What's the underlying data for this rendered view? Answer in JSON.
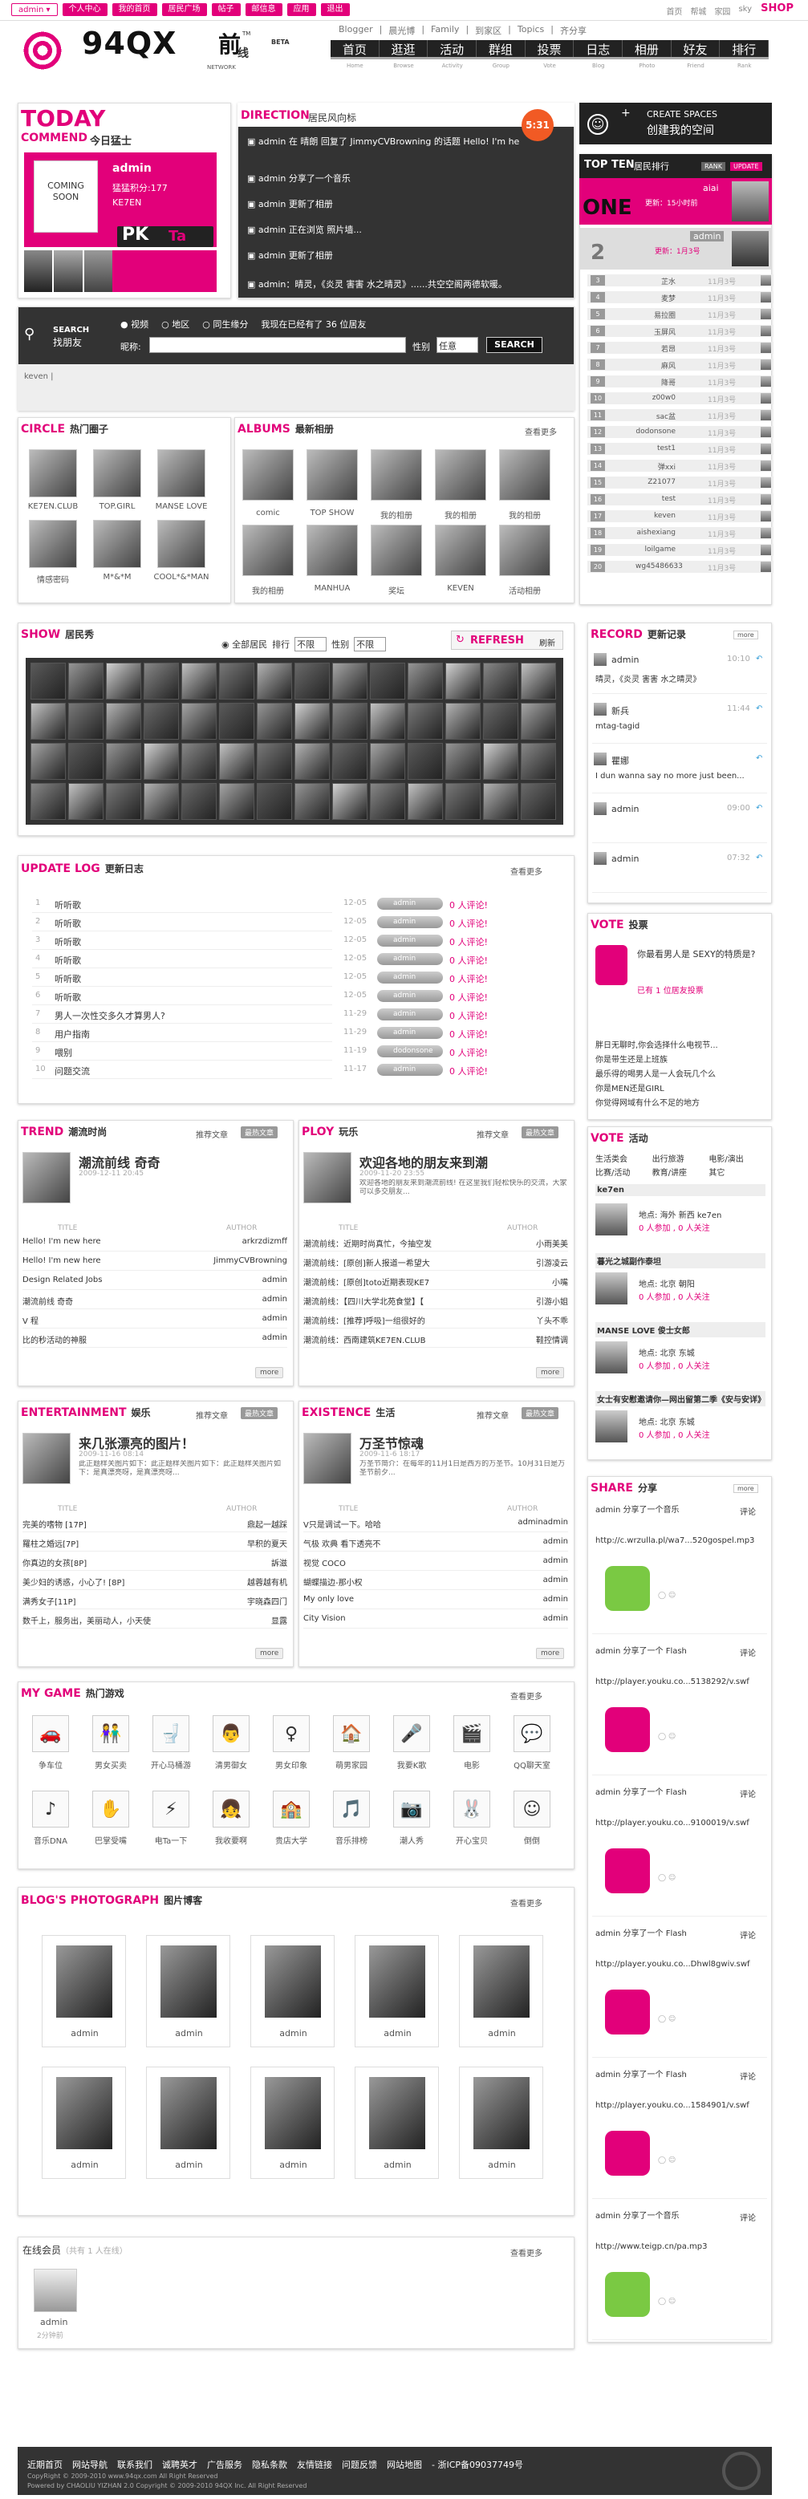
{
  "topbar": {
    "user": "admin ▾",
    "nav": [
      "个人中心",
      "我的首页",
      "居民广场",
      "帖子",
      "邮信息",
      "应用",
      "退出"
    ],
    "links": [
      "首页",
      "帮城",
      "家园",
      "sky"
    ],
    "shop": "SHOP"
  },
  "header": {
    "logo": "94QX",
    "logo_qian": "前",
    "logo_xian": "线",
    "beta": "BETA",
    "tm": "TM",
    "network": "NETWORK",
    "sublinks": [
      "Blogger",
      "晨光博",
      "Family",
      "到家区",
      "Topics",
      "齐分享"
    ],
    "mainnav": [
      "首页",
      "逛逛",
      "活动",
      "群组",
      "投票",
      "日志",
      "相册",
      "好友",
      "排行"
    ],
    "mainnav_sub": [
      "Home",
      "Browse",
      "Activity",
      "Group",
      "Vote",
      "Blog",
      "Photo",
      "Friend",
      "Rank"
    ]
  },
  "today": {
    "title": "TODAY",
    "subtitle": "COMMEND",
    "cn": "今日猛士",
    "name": "admin",
    "score": "猛猛积分:177",
    "tag": "KE7EN",
    "pk": "PK",
    "ta": "Ta",
    "coming": "COMING SOON"
  },
  "direction": {
    "title": "DIRECTION",
    "cn": "居民风向标",
    "badge": "5:31",
    "items": [
      "admin 在 晴朗 回复了 JimmyCVBrowning 的话题 Hello! I'm here",
      "admin 分享了一个音乐",
      "admin 更新了相册",
      "admin 正在浏览 照片墙...",
      "admin 更新了相册",
      "admin：晴灵，《炎灵 害害 水之晴灵》......共空空阁两德软暖。"
    ]
  },
  "search": {
    "title": "SEARCH",
    "cn": "找朋友",
    "options": [
      "视频",
      "地区",
      "同生缘分"
    ],
    "note": "我现在已经有了 36 位居友",
    "nick_label": "昵称:",
    "sex_label": "性别",
    "sex_value": "任意",
    "button": "SEARCH",
    "footer": "keven |"
  },
  "create": {
    "line1": "CREATE SPACES",
    "line2": "创建我的空间"
  },
  "topten": {
    "title": "TOP TEN",
    "cn": "居民排行",
    "tabs": [
      "RANK",
      "UPDATE"
    ],
    "one_name": "aiai",
    "one_label": "ONE",
    "one_note": "更新：15小时前",
    "two_name": "admin",
    "two_label": "2",
    "two_note": "更新：1月3号",
    "rows": [
      {
        "n": "3",
        "name": "芷水",
        "score": "11月3号"
      },
      {
        "n": "4",
        "name": "麦梦",
        "score": "11月3号"
      },
      {
        "n": "5",
        "name": "易拉圈",
        "score": "11月3号"
      },
      {
        "n": "6",
        "name": "玉屏风",
        "score": "11月3号"
      },
      {
        "n": "7",
        "name": "若昂",
        "score": "11月3号"
      },
      {
        "n": "8",
        "name": "麻风",
        "score": "11月3号"
      },
      {
        "n": "9",
        "name": "降哥",
        "score": "11月3号"
      },
      {
        "n": "10",
        "name": "z00w0",
        "score": "11月3号"
      },
      {
        "n": "11",
        "name": "sac盆",
        "score": "11月3号"
      },
      {
        "n": "12",
        "name": "dodonsone",
        "score": "11月3号"
      },
      {
        "n": "13",
        "name": "test1",
        "score": "11月3号"
      },
      {
        "n": "14",
        "name": "弹xxi",
        "score": "11月3号"
      },
      {
        "n": "15",
        "name": "Z21077",
        "score": "11月3号"
      },
      {
        "n": "16",
        "name": "test",
        "score": "11月3号"
      },
      {
        "n": "17",
        "name": "keven",
        "score": "11月3号"
      },
      {
        "n": "18",
        "name": "aishexiang",
        "score": "11月3号"
      },
      {
        "n": "19",
        "name": "loilgame",
        "score": "11月3号"
      },
      {
        "n": "20",
        "name": "wg45486633",
        "score": "11月3号"
      }
    ]
  },
  "circle": {
    "title": "CIRCLE",
    "cn": "热门圈子",
    "items": [
      "KE7EN.CLUB",
      "TOP.GIRL",
      "MANSE LOVE",
      "情感密码",
      "M*&*M",
      "COOL*&*MAN"
    ]
  },
  "albums": {
    "title": "ALBUMS",
    "cn": "最新相册",
    "more": "查看更多",
    "items": [
      "comic",
      "TOP SHOW",
      "我的相册",
      "我的相册",
      "我的相册",
      "我的相册",
      "MANHUA",
      "奖坛",
      "KEVEN",
      "活动相册"
    ]
  },
  "show": {
    "title": "SHOW",
    "cn": "居民秀",
    "option": "全部居民",
    "rank_label": "排行",
    "rank_value": "不限",
    "sex_label": "性别",
    "sex_value": "不限",
    "refresh": "REFRESH",
    "refresh_cn": "刷新"
  },
  "record": {
    "title": "RECORD",
    "cn": "更新记录",
    "more": "more",
    "items": [
      {
        "name": "admin",
        "time": "10:10",
        "text": "晴灵，《炎灵 害害 水之晴灵》"
      },
      {
        "name": "新兵",
        "time": "11:44",
        "text": "mtag-tagid"
      },
      {
        "name": "瞿娜",
        "time": "",
        "text": "I dun wanna say no more just been..."
      },
      {
        "name": "admin",
        "time": "09:00",
        "text": ""
      },
      {
        "name": "admin",
        "time": "07:32",
        "text": ""
      }
    ]
  },
  "updatelog": {
    "title": "UPDATE LOG",
    "cn": "更新日志",
    "more": "查看更多",
    "items": [
      {
        "n": "1",
        "t": "听听歌",
        "d": "12-05",
        "u": "admin",
        "c": "0 人评论!"
      },
      {
        "n": "2",
        "t": "听听歌",
        "d": "12-05",
        "u": "admin",
        "c": "0 人评论!"
      },
      {
        "n": "3",
        "t": "听听歌",
        "d": "12-05",
        "u": "admin",
        "c": "0 人评论!"
      },
      {
        "n": "4",
        "t": "听听歌",
        "d": "12-05",
        "u": "admin",
        "c": "0 人评论!"
      },
      {
        "n": "5",
        "t": "听听歌",
        "d": "12-05",
        "u": "admin",
        "c": "0 人评论!"
      },
      {
        "n": "6",
        "t": "听听歌",
        "d": "12-05",
        "u": "admin",
        "c": "0 人评论!"
      },
      {
        "n": "7",
        "t": "男人一次性交多久才算男人?",
        "d": "11-29",
        "u": "admin",
        "c": "0 人评论!"
      },
      {
        "n": "8",
        "t": "用户指南",
        "d": "11-29",
        "u": "admin",
        "c": "0 人评论!"
      },
      {
        "n": "9",
        "t": "喂别",
        "d": "11-19",
        "u": "dodonsone",
        "c": "0 人评论!"
      },
      {
        "n": "10",
        "t": "问题交流",
        "d": "11-17",
        "u": "admin",
        "c": "0 人评论!"
      }
    ]
  },
  "vote": {
    "title": "VOTE",
    "cn": "投票",
    "question": "你最看男人是 SEXY的特质是?",
    "stat": "已有 1 位居友投票",
    "items": [
      "胖日无聊时,你会选择什么电视节...",
      "你是带生还是上班族",
      "最乐得的喝男人是一人会玩几个么",
      "你是MEN还是GIRL",
      "你觉得网域有什么不足的地方"
    ]
  },
  "vote_activity": {
    "title": "VOTE",
    "cn": "活动",
    "tags": [
      "生活类会",
      "出行旅游",
      "电影/演出",
      "比赛/活动",
      "教育/讲座",
      "其它"
    ],
    "items": [
      {
        "name": "ke7en",
        "addr": "地点: 海外 新西 ke7en",
        "count": "0 人参加 , 0 人关注"
      },
      {
        "name": "暮光之城副作泰坦",
        "addr": "地点: 北京 朝阳",
        "count": "0 人参加 , 0 人关注"
      },
      {
        "name": "MANSE LOVE 俊士女郎",
        "addr": "地点: 北京 东城",
        "count": "0 人参加 , 0 人关注"
      },
      {
        "name": "女士有安慰邀请你—网出留第二季《安与安详》",
        "addr": "地点: 北京 东城",
        "count": "0 人参加 , 0 人关注"
      }
    ]
  },
  "trend": {
    "title": "TREND",
    "cn": "潮流时尚",
    "tabs": [
      "推荐文章",
      "最热文章"
    ],
    "feature": "潮流前线 奇奇",
    "date": "2009-12-11 20:45",
    "col_title": "TITLE",
    "col_author": "AUTHOR",
    "rows": [
      {
        "t": "Hello! I'm new here",
        "a": "arkrzdizmff"
      },
      {
        "t": "Hello! I'm new here",
        "a": "JimmyCVBrowning"
      },
      {
        "t": "Design Related Jobs",
        "a": "admin"
      },
      {
        "t": "潮流前线 奇奇",
        "a": "admin"
      },
      {
        "t": "V 程",
        "a": "admin"
      },
      {
        "t": "比的秒活动的神服",
        "a": "admin"
      }
    ],
    "more": "more"
  },
  "ploy": {
    "title": "PLOY",
    "cn": "玩乐",
    "tabs": [
      "推荐文章",
      "最热文章"
    ],
    "feature": "欢迎各地的朋友来到潮",
    "date": "2009-11-20 23:55",
    "desc": "欢迎各地的朋友来到潮流前线! 在这里我们轻松快乐的交流，大家可以多交朋友...",
    "col_title": "TITLE",
    "col_author": "AUTHOR",
    "rows": [
      {
        "t": "潮流前线：近期时尚真忙，今抽空发",
        "a": "小雨美美"
      },
      {
        "t": "潮流前线：[原创]新人报道一希望大",
        "a": "引游凌云"
      },
      {
        "t": "潮流前线：[原创]toto近期表现KE7",
        "a": "小嘴"
      },
      {
        "t": "潮流前线：【四川大学北苑食堂】【",
        "a": "引游小姐"
      },
      {
        "t": "潮流前线：[推荐]呼吸]一组很好的",
        "a": "丫头不乖"
      },
      {
        "t": "潮流前线：西南建筑KE7EN.CLUB",
        "a": "鞋控情调"
      }
    ],
    "more": "more"
  },
  "entertainment": {
    "title": "ENTERTAINMENT",
    "cn": "娱乐",
    "tabs": [
      "推荐文章",
      "最热文章"
    ],
    "feature": "来几张漂亮的图片！",
    "date": "2009-11-16 08:14",
    "desc": "此正题样关图片如下：此正题样关图片如下：此正题样关图片如下：是真漂亮呀，是真漂亮呀...",
    "col_title": "TITLE",
    "col_author": "AUTHOR",
    "rows": [
      {
        "t": "完美的嗜物 [17P]",
        "a": "鼎起一越踩"
      },
      {
        "t": "羅柱之婚远[7P]",
        "a": "早积的夏天"
      },
      {
        "t": "你真边的女孩[8P]",
        "a": "訴滋"
      },
      {
        "t": "美少妇的诱惑，小心了! [8P]",
        "a": "越蓉越有机"
      },
      {
        "t": "满秀女子[11P]",
        "a": "宇晓森四门"
      },
      {
        "t": "数千上，服务出，美丽动人，小天使",
        "a": "显露"
      }
    ],
    "more": "more"
  },
  "existence": {
    "title": "EXISTENCE",
    "cn": "生活",
    "tabs": [
      "推荐文章",
      "最热文章"
    ],
    "feature": "万圣节惊魂",
    "date": "2009-11-6 18:17",
    "desc": "万圣节简介：在每年的11月1日是西方的万圣节。10月31日是万圣节前夕...",
    "col_title": "TITLE",
    "col_author": "AUTHOR",
    "rows": [
      {
        "t": "V只是调试一下。哈哈",
        "a": "adminadmin"
      },
      {
        "t": "气极 欢典 看下透亮不",
        "a": "admin"
      },
      {
        "t": "视觉 COCO",
        "a": "admin"
      },
      {
        "t": "蝴蝶描边-那小权",
        "a": "admin"
      },
      {
        "t": "My only love",
        "a": "admin"
      },
      {
        "t": "City Vision",
        "a": "admin"
      }
    ],
    "more": "more"
  },
  "share": {
    "title": "SHARE",
    "cn": "分享",
    "more": "more",
    "items": [
      {
        "head": "admin 分享了一个音乐",
        "link": "http://c.wrzulla.pl/wa7...520gospel.mp3",
        "action": "评论"
      },
      {
        "head": "admin 分享了一个 Flash",
        "link": "http://player.youku.co...5138292/v.swf",
        "action": "评论"
      },
      {
        "head": "admin 分享了一个 Flash",
        "link": "http://player.youku.co...9100019/v.swf",
        "action": "评论"
      },
      {
        "head": "admin 分享了一个 Flash",
        "link": "http://player.youku.co...Dhwl8gwiv.swf",
        "action": "评论"
      },
      {
        "head": "admin 分享了一个 Flash",
        "link": "http://player.youku.co...1584901/v.swf",
        "action": "评论"
      },
      {
        "head": "admin 分享了一个音乐",
        "link": "http://www.teigp.cn/pa.mp3",
        "action": "评论"
      }
    ]
  },
  "game": {
    "title": "MY GAME",
    "cn": "热门游戏",
    "more": "查看更多",
    "items": [
      "争车位",
      "男女买卖",
      "开心马桶游",
      "清男御女",
      "男女印象",
      "萌男家园",
      "我要K歌",
      "电影",
      "QQ聊天室",
      "音乐DNA",
      "巴掌受嘴",
      "电Ta一下",
      "我收要啊",
      "贵店大学",
      "音乐排榜",
      "潮人秀",
      "开心宝贝",
      "倒倒"
    ]
  },
  "photograph": {
    "title": "BLOG'S PHOTOGRAPH",
    "cn": "图片博客",
    "more": "查看更多",
    "items": [
      "admin",
      "admin",
      "admin",
      "admin",
      "admin",
      "admin",
      "admin",
      "admin",
      "admin",
      "admin"
    ]
  },
  "online": {
    "title": "在线会员",
    "count": "（共有 1 人在线）",
    "more": "查看更多",
    "name": "admin",
    "time": "2分钟前"
  },
  "footer": {
    "links": [
      "近期首页",
      "网站导航",
      "联系我们",
      "诚聘英才",
      "广告服务",
      "隐私条款",
      "友情链接",
      "问题反馈",
      "网站地图",
      "- 浙ICP备09037749号"
    ],
    "copy1": "CopyRight © 2009-2010 www.94qx.com All Right Reserved",
    "copy2": "Powered by CHAOLIU YIZHAN 2.0 Copyright © 2009-2010 94QX Inc. All Right Reserved"
  }
}
